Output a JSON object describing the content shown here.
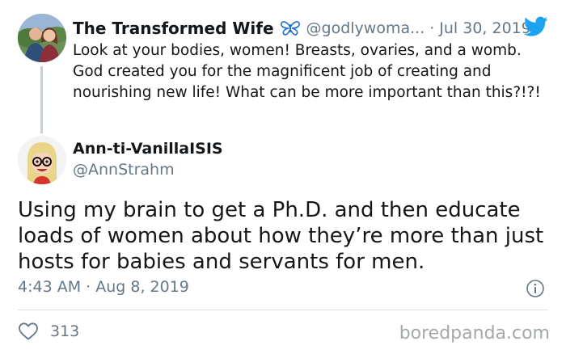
{
  "parent_tweet": {
    "display_name": "The Transformed Wife",
    "name_icon": "butterfly-icon",
    "handle": "@godlywoma...",
    "separator": "·",
    "date": "Jul 30, 2019",
    "text": "Look at your bodies, women! Breasts, ovaries, and a womb. God created you for the magnificent job of creating and nourishing new life! What can be more important than this?!?!",
    "brand_icon": "twitter-bird-icon"
  },
  "tweet": {
    "display_name": "Ann-ti-VanillaISIS",
    "handle": "@AnnStrahm",
    "text": "Using my brain to get a Ph.D. and then educate loads of women about how they’re more than just hosts for babies and servants for men.",
    "timestamp": "4:43 AM · Aug 8, 2019",
    "like_count": "313",
    "info_icon": "info-icon",
    "like_icon": "heart-icon"
  },
  "watermark": "boredpanda.com",
  "colors": {
    "twitter_blue": "#1da1f2",
    "secondary_text": "#657786",
    "primary_text": "#14171a",
    "thread_line": "#c8d0d6"
  }
}
